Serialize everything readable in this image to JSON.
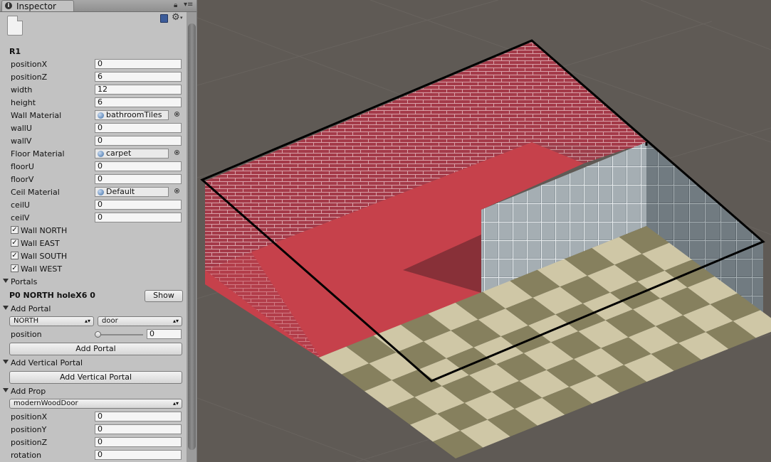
{
  "window": {
    "tab_title": "Inspector",
    "tab_icon": "i"
  },
  "header": {
    "object_name": "R1"
  },
  "room": {
    "positionX": {
      "label": "positionX",
      "value": "0"
    },
    "positionZ": {
      "label": "positionZ",
      "value": "6"
    },
    "width": {
      "label": "width",
      "value": "12"
    },
    "height": {
      "label": "height",
      "value": "6"
    },
    "wall_material": {
      "label": "Wall Material",
      "value": "bathroomTiles"
    },
    "wallU": {
      "label": "wallU",
      "value": "0"
    },
    "wallV": {
      "label": "wallV",
      "value": "0"
    },
    "floor_material": {
      "label": "Floor Material",
      "value": "carpet"
    },
    "floorU": {
      "label": "floorU",
      "value": "0"
    },
    "floorV": {
      "label": "floorV",
      "value": "0"
    },
    "ceil_material": {
      "label": "Ceil Material",
      "value": "Default"
    },
    "ceilU": {
      "label": "ceilU",
      "value": "0"
    },
    "ceilV": {
      "label": "ceilV",
      "value": "0"
    }
  },
  "walls": [
    {
      "label": "Wall NORTH",
      "checked": true
    },
    {
      "label": "Wall EAST",
      "checked": true
    },
    {
      "label": "Wall SOUTH",
      "checked": true
    },
    {
      "label": "Wall WEST",
      "checked": true
    }
  ],
  "checkmark": "✓",
  "portals": {
    "title": "Portals",
    "item": "P0 NORTH holeX6 0",
    "show_label": "Show"
  },
  "add_portal": {
    "title": "Add Portal",
    "direction": "NORTH",
    "type": "door",
    "position_label": "position",
    "position_value": "0",
    "position_fraction": 0,
    "button": "Add Portal"
  },
  "add_vertical_portal": {
    "title": "Add Vertical Portal",
    "button": "Add Vertical Portal"
  },
  "add_prop": {
    "title": "Add Prop",
    "prop": "modernWoodDoor",
    "positionX": {
      "label": "positionX",
      "value": "0"
    },
    "positionY": {
      "label": "positionY",
      "value": "0"
    },
    "positionZ": {
      "label": "positionZ",
      "value": "0"
    },
    "rotation": {
      "label": "rotation",
      "value": "0"
    }
  },
  "colors": {
    "panel": "#c2c2c2",
    "scene_bg": "#5f5a55",
    "brick": "#a03a48",
    "carpet": "#c5404a",
    "tiles": "#8d979e",
    "checker_light": "#cfc7a6",
    "checker_dark": "#86805e"
  }
}
